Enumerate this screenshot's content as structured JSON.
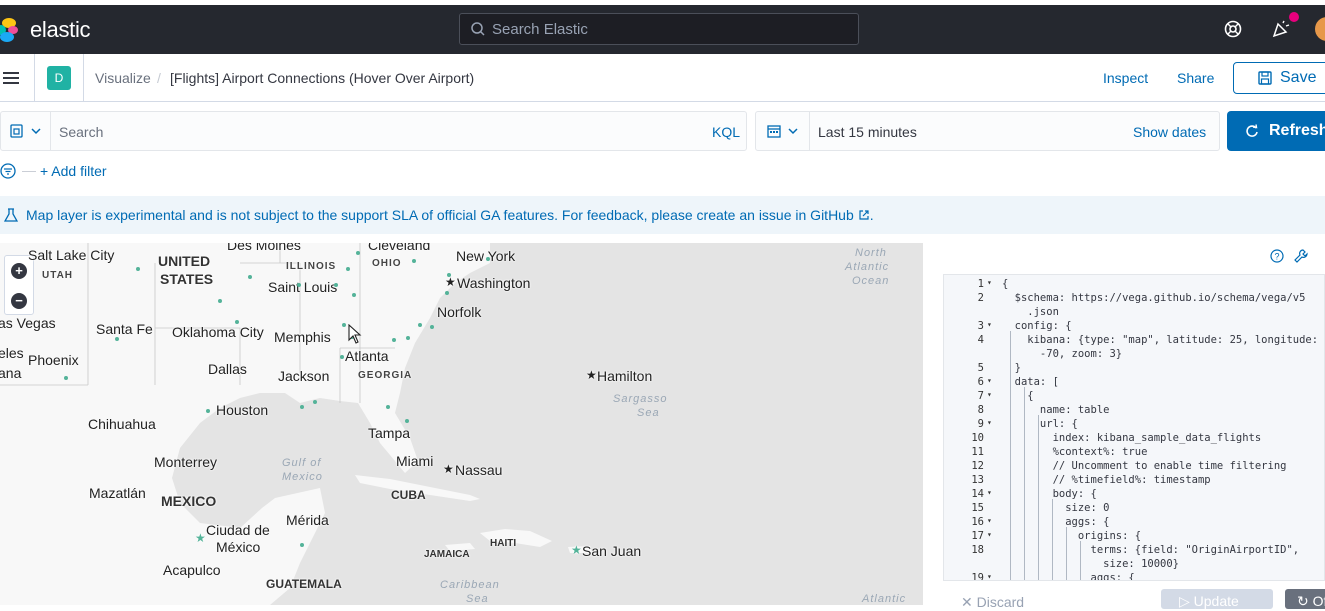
{
  "app": {
    "logo_text": "elastic",
    "search_placeholder": "Search Elastic"
  },
  "header": {
    "space_initial": "D",
    "breadcrumb_root": "Visualize",
    "breadcrumb_separator": "/",
    "breadcrumb_current": "[Flights] Airport Connections (Hover Over Airport)",
    "inspect_label": "Inspect",
    "share_label": "Share",
    "save_label": "Save"
  },
  "query": {
    "placeholder": "Search",
    "language": "KQL",
    "time_range": "Last 15 minutes",
    "show_dates_label": "Show dates",
    "refresh_label": "Refresh"
  },
  "filters": {
    "add_filter_label": "+ Add filter"
  },
  "callout": {
    "text": "Map layer is experimental and is not subject to the support SLA of official GA features. For feedback, please create an issue in GitHub",
    "link_icon": "external-link-icon"
  },
  "map": {
    "cities": [
      "Salt Lake City",
      "Des Moines",
      "Cleveland",
      "New York",
      "Saint Louis",
      "Washington",
      "Las Vegas",
      "Santa Fe",
      "Oklahoma City",
      "Memphis",
      "Norfolk",
      "Phoenix",
      "Atlanta",
      "Dallas",
      "Jackson",
      "Hamilton",
      "Houston",
      "Chihuahua",
      "Tampa",
      "Monterrey",
      "Miami",
      "Nassau",
      "Mazatlán",
      "Mérida",
      "Ciudad de",
      "México",
      "San Juan",
      "Acapulco"
    ],
    "countries": [
      "UNITED",
      "STATES",
      "MEXICO",
      "CUBA",
      "GUATEMALA"
    ],
    "states": [
      "UTAH",
      "ILLINOIS",
      "OHIO",
      "GEORGIA"
    ],
    "islands": [
      "JAMAICA",
      "HAITI"
    ],
    "seas": [
      "North",
      "Atlantic",
      "Ocean",
      "Sargasso",
      "Sea",
      "Gulf of",
      "Mexico",
      "Caribbean",
      "Atlantic"
    ],
    "edge_fragments": [
      "as Vegas",
      "eles",
      "ana"
    ]
  },
  "editor": {
    "lines": [
      {
        "n": "1",
        "fold": true,
        "code": "{"
      },
      {
        "n": "2",
        "fold": false,
        "code": "  $schema: https://vega.github.io/schema/vega/v5"
      },
      {
        "n": "",
        "fold": false,
        "code": "    .json"
      },
      {
        "n": "3",
        "fold": true,
        "code": "  config: {"
      },
      {
        "n": "4",
        "fold": false,
        "code": "    kibana: {type: \"map\", latitude: 25, longitude:"
      },
      {
        "n": "",
        "fold": false,
        "code": "      -70, zoom: 3}"
      },
      {
        "n": "5",
        "fold": false,
        "code": "  }"
      },
      {
        "n": "6",
        "fold": true,
        "code": "  data: ["
      },
      {
        "n": "7",
        "fold": true,
        "code": "    {"
      },
      {
        "n": "8",
        "fold": false,
        "code": "      name: table"
      },
      {
        "n": "9",
        "fold": true,
        "code": "      url: {"
      },
      {
        "n": "10",
        "fold": false,
        "code": "        index: kibana_sample_data_flights"
      },
      {
        "n": "11",
        "fold": false,
        "code": "        %context%: true"
      },
      {
        "n": "12",
        "fold": false,
        "code": "        // Uncomment to enable time filtering"
      },
      {
        "n": "13",
        "fold": false,
        "code": "        // %timefield%: timestamp"
      },
      {
        "n": "14",
        "fold": true,
        "code": "        body: {"
      },
      {
        "n": "15",
        "fold": false,
        "code": "          size: 0"
      },
      {
        "n": "16",
        "fold": true,
        "code": "          aggs: {"
      },
      {
        "n": "17",
        "fold": true,
        "code": "            origins: {"
      },
      {
        "n": "18",
        "fold": false,
        "code": "              terms: {field: \"OriginAirportID\","
      },
      {
        "n": "",
        "fold": false,
        "code": "                size: 10000}"
      },
      {
        "n": "19",
        "fold": true,
        "code": "              aggs: {"
      }
    ],
    "discard_label": "Discard",
    "update_label": "Update",
    "off_label": "Of"
  },
  "colors": {
    "accent": "#006bb4",
    "topbar": "#25282f",
    "dot": "#54b399"
  }
}
